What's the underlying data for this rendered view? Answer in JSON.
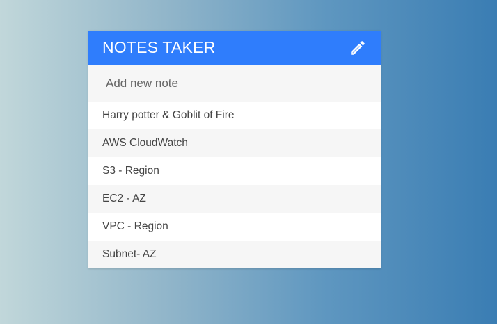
{
  "app": {
    "title": "NOTES TAKER",
    "accent_color": "#2f7dfc",
    "header_icon": "pencil-icon"
  },
  "add_note": {
    "placeholder": "Add new note",
    "value": ""
  },
  "notes": [
    {
      "text": "Harry potter & Goblit of Fire"
    },
    {
      "text": "AWS CloudWatch"
    },
    {
      "text": "S3 - Region"
    },
    {
      "text": "EC2 - AZ"
    },
    {
      "text": "VPC - Region"
    },
    {
      "text": "Subnet- AZ"
    }
  ]
}
